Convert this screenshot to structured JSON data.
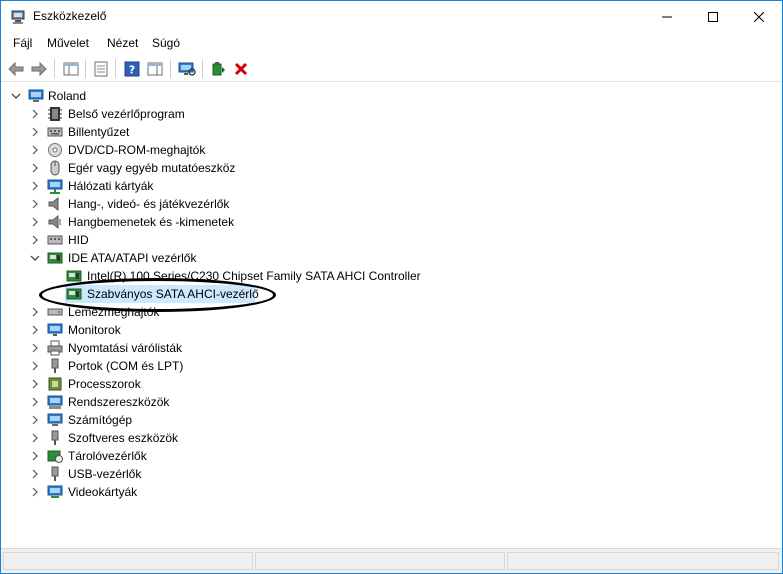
{
  "window": {
    "title": "Eszközkezelő",
    "icon": "device-manager-icon"
  },
  "menu": {
    "items": [
      "Fájl",
      "Művelet",
      "Nézet",
      "Súgó"
    ]
  },
  "toolbar": {
    "buttons": [
      "back-arrow-icon",
      "forward-arrow-icon",
      "show-hide-tree-icon",
      "properties-icon",
      "help-icon",
      "action-pane-icon",
      "scan-hardware-icon",
      "update-driver-icon",
      "uninstall-device-icon"
    ]
  },
  "tree": {
    "root": "Roland",
    "items": [
      {
        "label": "Belső vezérlőprogram",
        "icon": "firmware-icon",
        "expanded": false
      },
      {
        "label": "Billentyűzet",
        "icon": "keyboard-icon",
        "expanded": false
      },
      {
        "label": "DVD/CD-ROM-meghajtók",
        "icon": "dvd-drive-icon",
        "expanded": false
      },
      {
        "label": "Egér vagy egyéb mutatóeszköz",
        "icon": "mouse-icon",
        "expanded": false
      },
      {
        "label": "Hálózati kártyák",
        "icon": "network-adapter-icon",
        "expanded": false
      },
      {
        "label": "Hang-, videó- és játékvezérlők",
        "icon": "speaker-icon",
        "expanded": false
      },
      {
        "label": "Hangbemenetek és -kimenetek",
        "icon": "audio-io-icon",
        "expanded": false
      },
      {
        "label": "HID",
        "icon": "hid-icon",
        "expanded": false
      },
      {
        "label": "IDE ATA/ATAPI vezérlők",
        "icon": "ide-controller-icon",
        "expanded": true,
        "children": [
          {
            "label": "Intel(R) 100 Series/C230 Chipset Family SATA AHCI Controller",
            "icon": "ide-controller-icon"
          },
          {
            "label": "Szabványos SATA AHCI-vezérlő",
            "icon": "ide-controller-icon",
            "selected": true
          }
        ]
      },
      {
        "label": "Lemezmeghajtók",
        "icon": "disk-drive-icon",
        "expanded": false
      },
      {
        "label": "Monitorok",
        "icon": "monitor-icon",
        "expanded": false
      },
      {
        "label": "Nyomtatási várólisták",
        "icon": "printer-icon",
        "expanded": false
      },
      {
        "label": "Portok (COM és LPT)",
        "icon": "port-icon",
        "expanded": false
      },
      {
        "label": "Processzorok",
        "icon": "processor-icon",
        "expanded": false
      },
      {
        "label": "Rendszereszközök",
        "icon": "system-device-icon",
        "expanded": false
      },
      {
        "label": "Számítógép",
        "icon": "computer-icon",
        "expanded": false
      },
      {
        "label": "Szoftveres eszközök",
        "icon": "software-device-icon",
        "expanded": false
      },
      {
        "label": "Tárolóvezérlők",
        "icon": "storage-controller-icon",
        "expanded": false
      },
      {
        "label": "USB-vezérlők",
        "icon": "usb-controller-icon",
        "expanded": false
      },
      {
        "label": "Videokártyák",
        "icon": "display-adapter-icon",
        "expanded": false
      }
    ]
  },
  "annotation": {
    "highlight": "hand-drawn-ellipse"
  },
  "colors": {
    "accent": "#1883d7",
    "selection": "#cce8ff",
    "uninstall_red": "#d40000"
  }
}
